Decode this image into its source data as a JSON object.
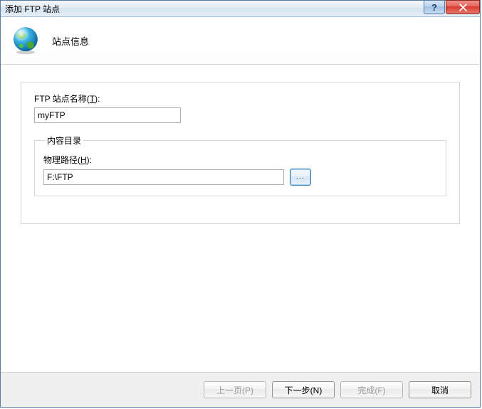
{
  "window": {
    "title": "添加 FTP 站点"
  },
  "header": {
    "heading": "站点信息"
  },
  "form": {
    "site_name_label_pre": "FTP 站点名称(",
    "site_name_label_u": "T",
    "site_name_label_post": "):",
    "site_name_value": "myFTP",
    "content_dir_legend": "内容目录",
    "physical_path_label_pre": "物理路径(",
    "physical_path_label_u": "H",
    "physical_path_label_post": "):",
    "physical_path_value": "F:\\FTP",
    "browse_label": "..."
  },
  "footer": {
    "prev": "上一页(P)",
    "next": "下一步(N)",
    "finish": "完成(F)",
    "cancel": "取消"
  }
}
